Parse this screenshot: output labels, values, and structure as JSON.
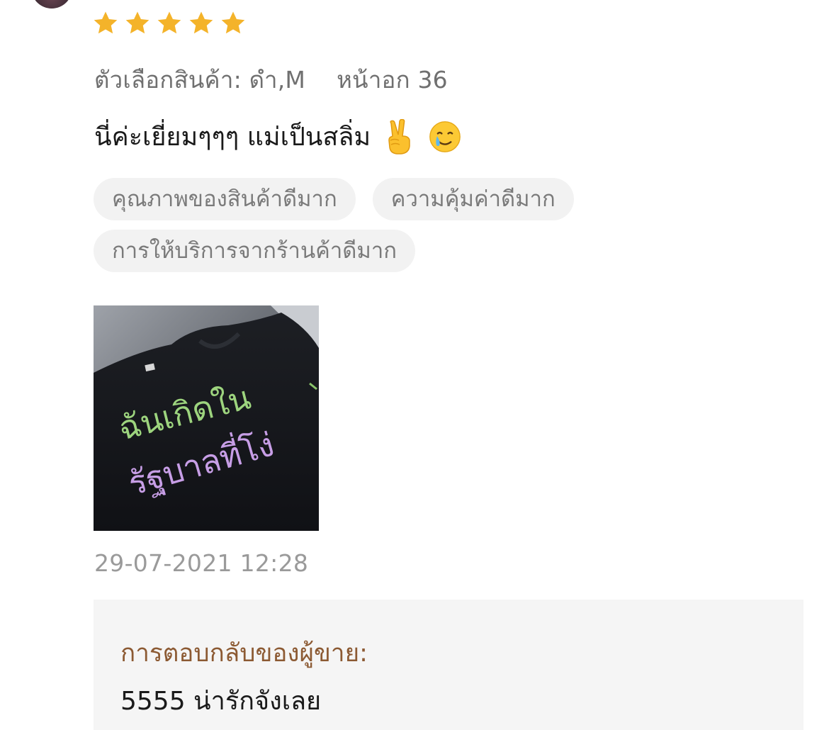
{
  "review": {
    "rating": 5,
    "rating_max": 5,
    "variation_label": "ตัวเลือกสินค้า: ดำ,M",
    "variation_extra": "หน้าอก 36",
    "comment_text": "นี่ค่ะเยี่ยมๆๆๆ แม่เป็นสลิ่ม",
    "comment_emojis": [
      "victory-hand-icon",
      "smiling-face-with-tear-icon"
    ],
    "tags": [
      "คุณภาพของสินค้าดีมาก",
      "ความคุ้มค่าดีมาก",
      "การให้บริการจากร้านค้าดีมาก"
    ],
    "photo": {
      "shirt_text_line1": "ฉันเกิดใน",
      "shirt_text_line2": "รัฐบาลที่โง่"
    },
    "timestamp": "29-07-2021 12:28"
  },
  "seller_reply": {
    "title": "การตอบกลับของผู้ขาย:",
    "text": "5555 น่ารักจังเลย"
  },
  "colors": {
    "star": "#f4b32a",
    "tag_bg": "#f2f2f2",
    "reply_bg": "#f5f5f5",
    "reply_title": "#8c5a33",
    "muted_text": "#707070"
  }
}
